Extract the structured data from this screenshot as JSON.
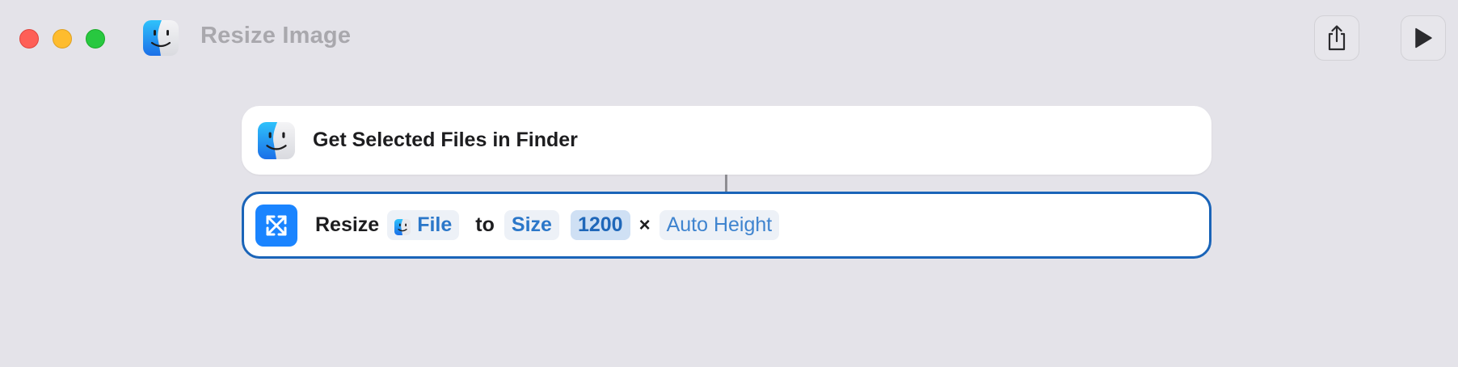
{
  "window": {
    "title": "Resize Image",
    "controls": [
      "close",
      "minimize",
      "zoom"
    ]
  },
  "toolbar": {
    "share_icon": "share-icon",
    "run_icon": "play-icon"
  },
  "actions": [
    {
      "icon": "finder-icon",
      "title": "Get Selected Files in Finder"
    },
    {
      "icon": "resize-arrows-icon",
      "verb": "Resize",
      "input_token": "File",
      "connector_word": "to",
      "mode_token": "Size",
      "width_value": "1200",
      "times_symbol": "×",
      "height_token": "Auto Height"
    }
  ],
  "colors": {
    "background": "#e4e3e9",
    "accent": "#1a84ff",
    "selected_border": "#1a64b8",
    "token_text": "#2b77c9"
  }
}
